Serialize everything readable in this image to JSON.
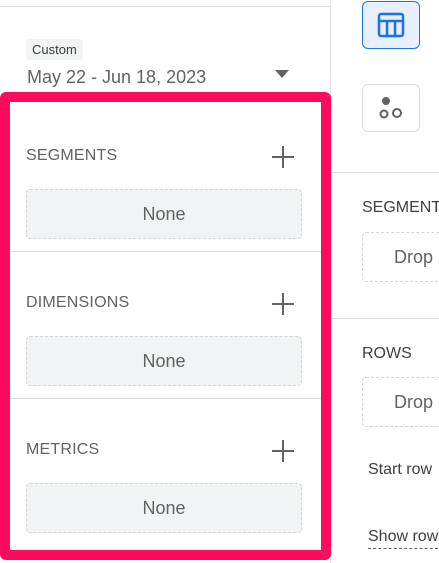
{
  "date_range": {
    "chip_label": "Custom",
    "value": "May 22 - Jun 18, 2023"
  },
  "variables": {
    "segments": {
      "title": "SEGMENTS",
      "value": "None"
    },
    "dimensions": {
      "title": "DIMENSIONS",
      "value": "None"
    },
    "metrics": {
      "title": "METRICS",
      "value": "None"
    }
  },
  "tab_settings": {
    "segment_comparisons": {
      "heading": "SEGMENT",
      "drop_text": "Drop"
    },
    "rows": {
      "heading": "ROWS",
      "drop_text": "Drop"
    },
    "start_row_label": "Start row",
    "show_rows_label": "Show row"
  },
  "colors": {
    "highlight": "#ff0b5e",
    "accent": "#1a73e8"
  },
  "icons": {
    "dropdown": "triangle-down-icon",
    "add": "plus-icon",
    "table_viz": "table-icon",
    "scatter_viz": "scatter-icon"
  }
}
